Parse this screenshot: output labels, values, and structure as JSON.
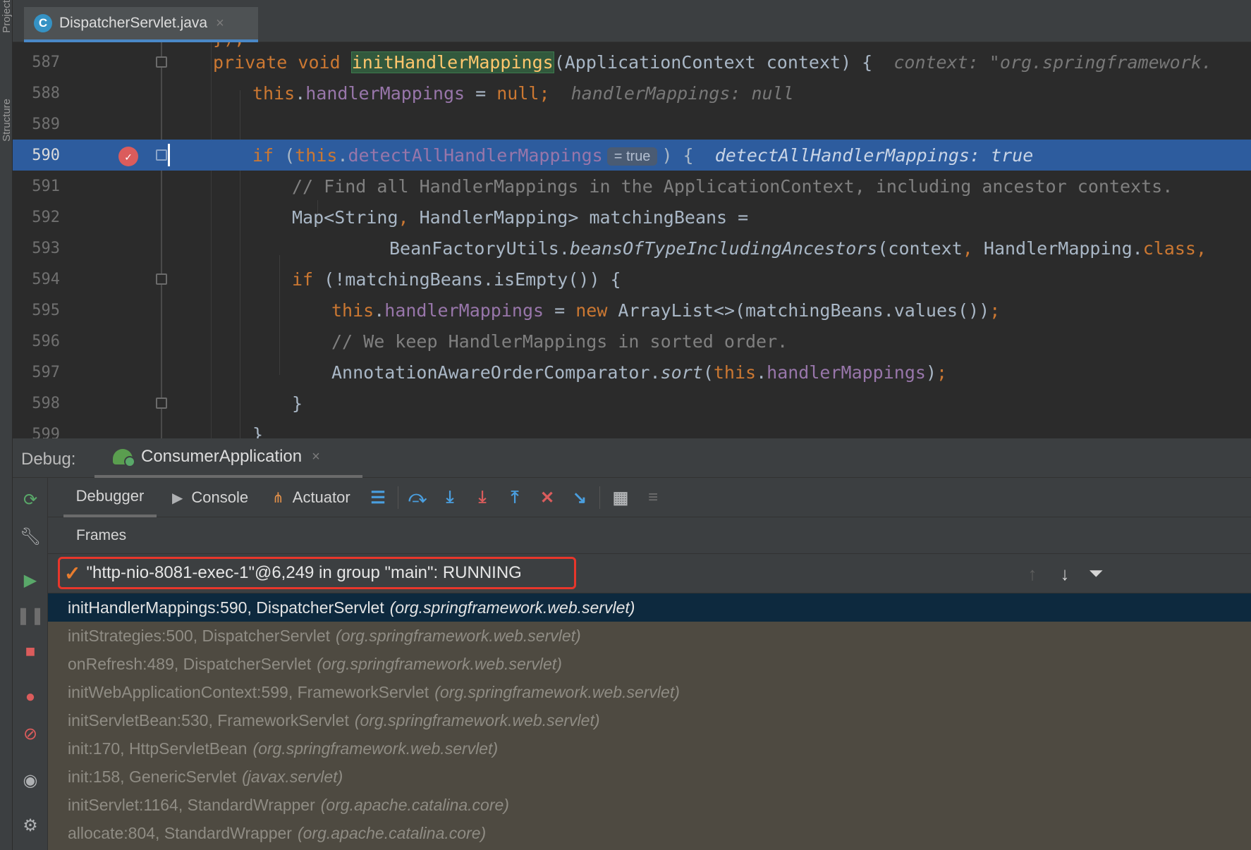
{
  "left_strip": {
    "project_label": "Project",
    "structure_label": "Structure"
  },
  "editor_tab": {
    "icon_letter": "C",
    "label": "DispatcherServlet.java",
    "close": "×"
  },
  "editor": {
    "top_partial": "});",
    "line_numbers": [
      "587",
      "588",
      "589",
      "590",
      "591",
      "592",
      "593",
      "594",
      "595",
      "596",
      "597",
      "598",
      "599"
    ],
    "l587": {
      "kw1": "private",
      "kw2": "void",
      "method": "initHandlerMappings",
      "params": "(ApplicationContext context) {",
      "hint": "context: \"org.springframework."
    },
    "l588": {
      "kw": "this",
      "field": "handlerMappings",
      "op": " = ",
      "kw2": "null",
      "semi": ";",
      "hint": "handlerMappings: null"
    },
    "l590": {
      "kw": "if",
      "paren": " (",
      "kw2": "this",
      "field": "detectAllHandlerMappings",
      "pill": "= true",
      "rest": ") {",
      "hint": "detectAllHandlerMappings: true"
    },
    "l591": {
      "comment": "// Find all HandlerMappings in the ApplicationContext, including ancestor contexts."
    },
    "l592": {
      "a": "Map<String",
      "b": ", ",
      "c": "HandlerMapping> matchingBeans ="
    },
    "l593": {
      "a": "BeanFactoryUtils.",
      "method": "beansOfTypeIncludingAncestors",
      "b": "(context",
      "c": ", ",
      "d": "HandlerMapping.",
      "kw": "class",
      "e": ","
    },
    "l594": {
      "kw": "if",
      "rest": " (!matchingBeans.isEmpty()) {"
    },
    "l595": {
      "kw": "this",
      "field": "handlerMappings",
      "op": " = ",
      "kw2": "new",
      "rest": " ArrayList<>(matchingBeans.values())",
      "semi": ";"
    },
    "l596": {
      "comment": "// We keep HandlerMappings in sorted order."
    },
    "l597": {
      "a": "AnnotationAwareOrderComparator.",
      "method": "sort",
      "b": "(",
      "kw": "this",
      "dot": ".",
      "field": "handlerMappings",
      "c": ")",
      "semi": ";"
    },
    "l598": {
      "text": "}"
    },
    "l599": {
      "text": "}"
    }
  },
  "debug": {
    "title": "Debug:",
    "session_label": "ConsumerApplication",
    "session_close": "×",
    "tabs": {
      "debugger": "Debugger",
      "console": "Console",
      "actuator": "Actuator"
    },
    "frames_label": "Frames",
    "thread": "\"http-nio-8081-exec-1\"@6,249 in group \"main\": RUNNING",
    "frames": [
      {
        "method": "initHandlerMappings:590, DispatcherServlet",
        "pkg": "(org.springframework.web.servlet)"
      },
      {
        "method": "initStrategies:500, DispatcherServlet",
        "pkg": "(org.springframework.web.servlet)"
      },
      {
        "method": "onRefresh:489, DispatcherServlet",
        "pkg": "(org.springframework.web.servlet)"
      },
      {
        "method": "initWebApplicationContext:599, FrameworkServlet",
        "pkg": "(org.springframework.web.servlet)"
      },
      {
        "method": "initServletBean:530, FrameworkServlet",
        "pkg": "(org.springframework.web.servlet)"
      },
      {
        "method": "init:170, HttpServletBean",
        "pkg": "(org.springframework.web.servlet)"
      },
      {
        "method": "init:158, GenericServlet",
        "pkg": "(javax.servlet)"
      },
      {
        "method": "initServlet:1164, StandardWrapper",
        "pkg": "(org.apache.catalina.core)"
      },
      {
        "method": "allocate:804, StandardWrapper",
        "pkg": "(org.apache.catalina.core)"
      }
    ]
  },
  "colors": {
    "editor_bg": "#2b2b2b",
    "panel_bg": "#3c3f41",
    "current_line": "#2d5c9e",
    "keyword": "#cc7832",
    "field": "#9876aa",
    "method": "#ffc66d",
    "selected_frame": "#0d293e",
    "frames_bg": "#4e4a41",
    "highlight_box": "#e8362b"
  },
  "icons": [
    "file-java-icon",
    "breakpoint-icon",
    "rerun-icon",
    "wrench-icon",
    "resume-icon",
    "pause-icon",
    "stop-icon",
    "view-breakpoints-icon",
    "mute-breakpoints-icon",
    "camera-icon",
    "settings-icon",
    "console-icon",
    "actuator-icon",
    "threads-icon",
    "step-over-icon",
    "step-into-icon",
    "force-step-into-icon",
    "step-out-icon",
    "drop-frame-icon",
    "run-to-cursor-icon",
    "evaluate-icon",
    "trace-icon",
    "check-icon",
    "arrow-up-icon",
    "arrow-down-icon",
    "filter-icon"
  ]
}
